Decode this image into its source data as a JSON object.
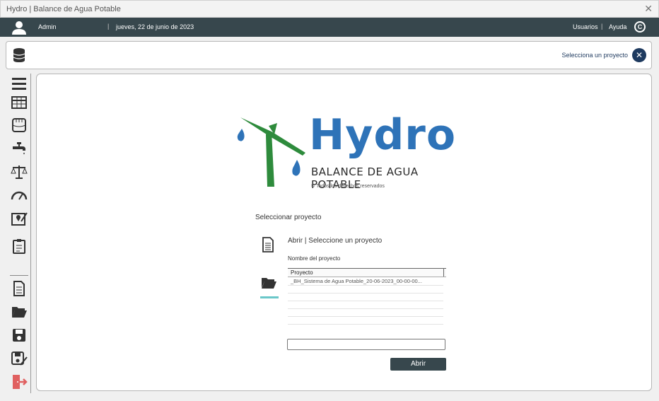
{
  "window": {
    "title": "Hydro | Balance de Agua Potable"
  },
  "topbar": {
    "username": "Admin",
    "date": "jueves, 22 de junio de 2023",
    "separator": "|",
    "usuarios": "Usuarios",
    "ayuda": "Ayuda"
  },
  "projectbar": {
    "select_text": "Selecciona un proyecto"
  },
  "sidebar": {
    "icons": [
      "menu-icon",
      "table-icon",
      "water-tank-icon",
      "faucet-icon",
      "scale-icon",
      "gauge-icon",
      "map-pin-icon",
      "clipboard-icon",
      "new-file-icon",
      "open-folder-icon",
      "save-icon",
      "save-as-icon",
      "exit-icon"
    ]
  },
  "logo": {
    "word": "Hydro",
    "subtitle": "BALANCE DE AGUA POTABLE",
    "rights": "© Todos los derechos reservados"
  },
  "open_panel": {
    "section_label": "Seleccionar proyecto",
    "title": "Abrir | Seleccione un proyecto",
    "name_label": "Nombre del proyecto",
    "column_header": "Proyecto",
    "rows": [
      "_BH_Sistema de Agua Potable_20-06-2023_00-00-00..."
    ],
    "input_value": "",
    "open_button": "Abrir"
  },
  "colors": {
    "dark_bar": "#37474d",
    "brand_blue": "#2e73b8",
    "brand_green": "#2e8b3c",
    "accent_teal": "#6ac7c9"
  }
}
